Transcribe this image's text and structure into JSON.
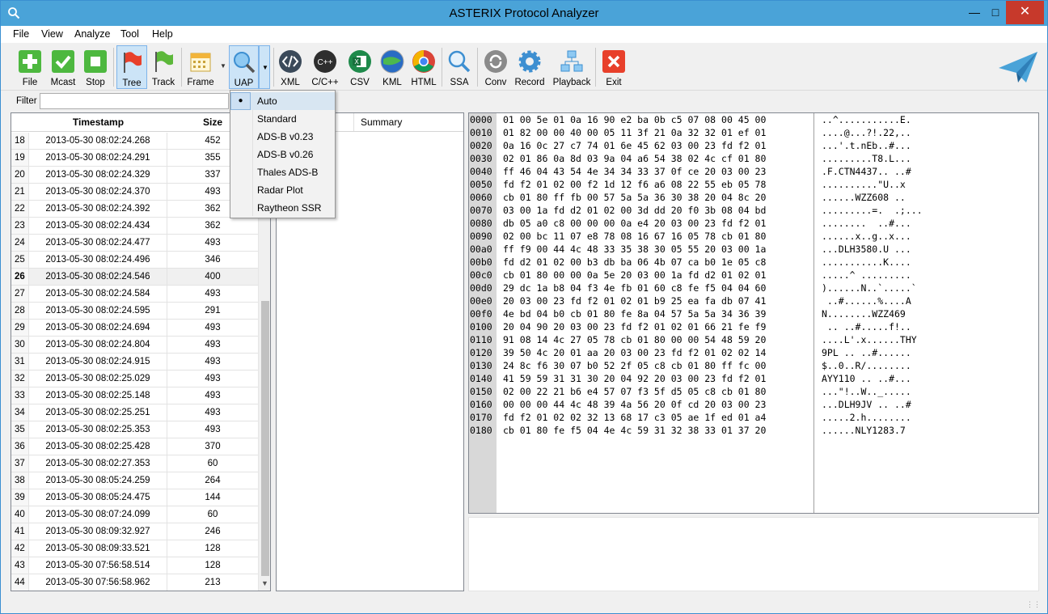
{
  "window": {
    "title": "ASTERIX Protocol Analyzer"
  },
  "menu": [
    "File",
    "View",
    "Analyze",
    "Tool",
    "Help"
  ],
  "toolbar": {
    "file": "File",
    "mcast": "Mcast",
    "stop": "Stop",
    "tree": "Tree",
    "track": "Track",
    "frame": "Frame",
    "uap": "UAP",
    "xml": "XML",
    "cpp": "C/C++",
    "csv": "CSV",
    "kml": "KML",
    "html": "HTML",
    "ssa": "SSA",
    "conv": "Conv",
    "record": "Record",
    "playback": "Playback",
    "exit": "Exit"
  },
  "filter": {
    "label": "Filter",
    "value": ""
  },
  "packets": {
    "col_timestamp": "Timestamp",
    "col_size": "Size",
    "selected_index": 8,
    "rows": [
      {
        "n": "18",
        "ts": "2013-05-30 08:02:24.268",
        "size": "452"
      },
      {
        "n": "19",
        "ts": "2013-05-30 08:02:24.291",
        "size": "355"
      },
      {
        "n": "20",
        "ts": "2013-05-30 08:02:24.329",
        "size": "337"
      },
      {
        "n": "21",
        "ts": "2013-05-30 08:02:24.370",
        "size": "493"
      },
      {
        "n": "22",
        "ts": "2013-05-30 08:02:24.392",
        "size": "362"
      },
      {
        "n": "23",
        "ts": "2013-05-30 08:02:24.434",
        "size": "362"
      },
      {
        "n": "24",
        "ts": "2013-05-30 08:02:24.477",
        "size": "493"
      },
      {
        "n": "25",
        "ts": "2013-05-30 08:02:24.496",
        "size": "346"
      },
      {
        "n": "26",
        "ts": "2013-05-30 08:02:24.546",
        "size": "400"
      },
      {
        "n": "27",
        "ts": "2013-05-30 08:02:24.584",
        "size": "493"
      },
      {
        "n": "28",
        "ts": "2013-05-30 08:02:24.595",
        "size": "291"
      },
      {
        "n": "29",
        "ts": "2013-05-30 08:02:24.694",
        "size": "493"
      },
      {
        "n": "30",
        "ts": "2013-05-30 08:02:24.804",
        "size": "493"
      },
      {
        "n": "31",
        "ts": "2013-05-30 08:02:24.915",
        "size": "493"
      },
      {
        "n": "32",
        "ts": "2013-05-30 08:02:25.029",
        "size": "493"
      },
      {
        "n": "33",
        "ts": "2013-05-30 08:02:25.148",
        "size": "493"
      },
      {
        "n": "34",
        "ts": "2013-05-30 08:02:25.251",
        "size": "493"
      },
      {
        "n": "35",
        "ts": "2013-05-30 08:02:25.353",
        "size": "493"
      },
      {
        "n": "36",
        "ts": "2013-05-30 08:02:25.428",
        "size": "370"
      },
      {
        "n": "37",
        "ts": "2013-05-30 08:02:27.353",
        "size": "60"
      },
      {
        "n": "38",
        "ts": "2013-05-30 08:05:24.259",
        "size": "264"
      },
      {
        "n": "39",
        "ts": "2013-05-30 08:05:24.475",
        "size": "144"
      },
      {
        "n": "40",
        "ts": "2013-05-30 08:07:24.099",
        "size": "60"
      },
      {
        "n": "41",
        "ts": "2013-05-30 08:09:32.927",
        "size": "246"
      },
      {
        "n": "42",
        "ts": "2013-05-30 08:09:33.521",
        "size": "128"
      },
      {
        "n": "43",
        "ts": "2013-05-30 07:56:58.514",
        "size": "128"
      },
      {
        "n": "44",
        "ts": "2013-05-30 07:56:58.962",
        "size": "213"
      }
    ]
  },
  "tree": {
    "col_summary": "Summary"
  },
  "hex": {
    "offsets": [
      "0000",
      "0010",
      "0020",
      "0030",
      "0040",
      "0050",
      "0060",
      "0070",
      "0080",
      "0090",
      "00a0",
      "00b0",
      "00c0",
      "00d0",
      "00e0",
      "00f0",
      "0100",
      "0110",
      "0120",
      "0130",
      "0140",
      "0150",
      "0160",
      "0170",
      "0180"
    ],
    "bytes": [
      "01 00 5e 01 0a 16 90 e2 ba 0b c5 07 08 00 45 00",
      "01 82 00 00 40 00 05 11 3f 21 0a 32 32 01 ef 01",
      "0a 16 0c 27 c7 74 01 6e 45 62 03 00 23 fd f2 01",
      "02 01 86 0a 8d 03 9a 04 a6 54 38 02 4c cf 01 80",
      "ff 46 04 43 54 4e 34 34 33 37 0f ce 20 03 00 23",
      "fd f2 01 02 00 f2 1d 12 f6 a6 08 22 55 eb 05 78",
      "cb 01 80 ff fb 00 57 5a 5a 36 30 38 20 04 8c 20",
      "03 00 1a fd d2 01 02 00 3d dd 20 f0 3b 08 04 bd",
      "db 05 a0 c8 00 00 00 0a e4 20 03 00 23 fd f2 01",
      "02 00 bc 11 07 e8 78 08 16 67 16 05 78 cb 01 80",
      "ff f9 00 44 4c 48 33 35 38 30 05 55 20 03 00 1a",
      "fd d2 01 02 00 b3 db ba 06 4b 07 ca b0 1e 05 c8",
      "cb 01 80 00 00 0a 5e 20 03 00 1a fd d2 01 02 01",
      "29 dc 1a b8 04 f3 4e fb 01 60 c8 fe f5 04 04 60",
      "20 03 00 23 fd f2 01 02 01 b9 25 ea fa db 07 41",
      "4e bd 04 b0 cb 01 80 fe 8a 04 57 5a 5a 34 36 39",
      "20 04 90 20 03 00 23 fd f2 01 02 01 66 21 fe f9",
      "91 08 14 4c 27 05 78 cb 01 80 00 00 54 48 59 20",
      "39 50 4c 20 01 aa 20 03 00 23 fd f2 01 02 02 14",
      "24 8c f6 30 07 b0 52 2f 05 c8 cb 01 80 ff fc 00",
      "41 59 59 31 31 30 20 04 92 20 03 00 23 fd f2 01",
      "02 00 22 21 b6 e4 57 07 f3 5f d5 05 c8 cb 01 80",
      "00 00 00 44 4c 48 39 4a 56 20 0f cd 20 03 00 23",
      "fd f2 01 02 02 32 13 68 17 c3 05 ae 1f ed 01 a4",
      "cb 01 80 fe f5 04 4e 4c 59 31 32 38 33 01 37 20"
    ],
    "ascii": [
      "..^...........E.",
      "....@...?!.22,..",
      "...'.t.nEb..#...",
      ".........T8.L...",
      ".F.CTN4437.. ..#",
      "..........\"U..x",
      "......WZZ608 ..",
      ".........=.  .;...",
      "........  ..#...",
      "......x..g..x...",
      "...DLH3580.U ...",
      "...........K....",
      ".....^ .........",
      ")......N..`.....`",
      " ..#......%....A",
      "N........WZZ469",
      " .. ..#.....f!..",
      "....L'.x......THY",
      "9PL .. ..#......",
      "$..0..R/........",
      "AYY110 .. ..#...",
      "...\"!..W.._.....",
      "...DLH9JV .. ..#",
      ".....2.h........",
      "......NLY1283.7"
    ]
  },
  "uap_menu": {
    "items": [
      "Auto",
      "Standard",
      "ADS-B v0.23",
      "ADS-B v0.26",
      "Thales ADS-B",
      "Radar Plot",
      "Raytheon SSR"
    ],
    "checked": "Auto"
  },
  "colors": {
    "titlebar": "#4aa3d8",
    "close": "#c7392b",
    "selection": "#cde0f3"
  }
}
